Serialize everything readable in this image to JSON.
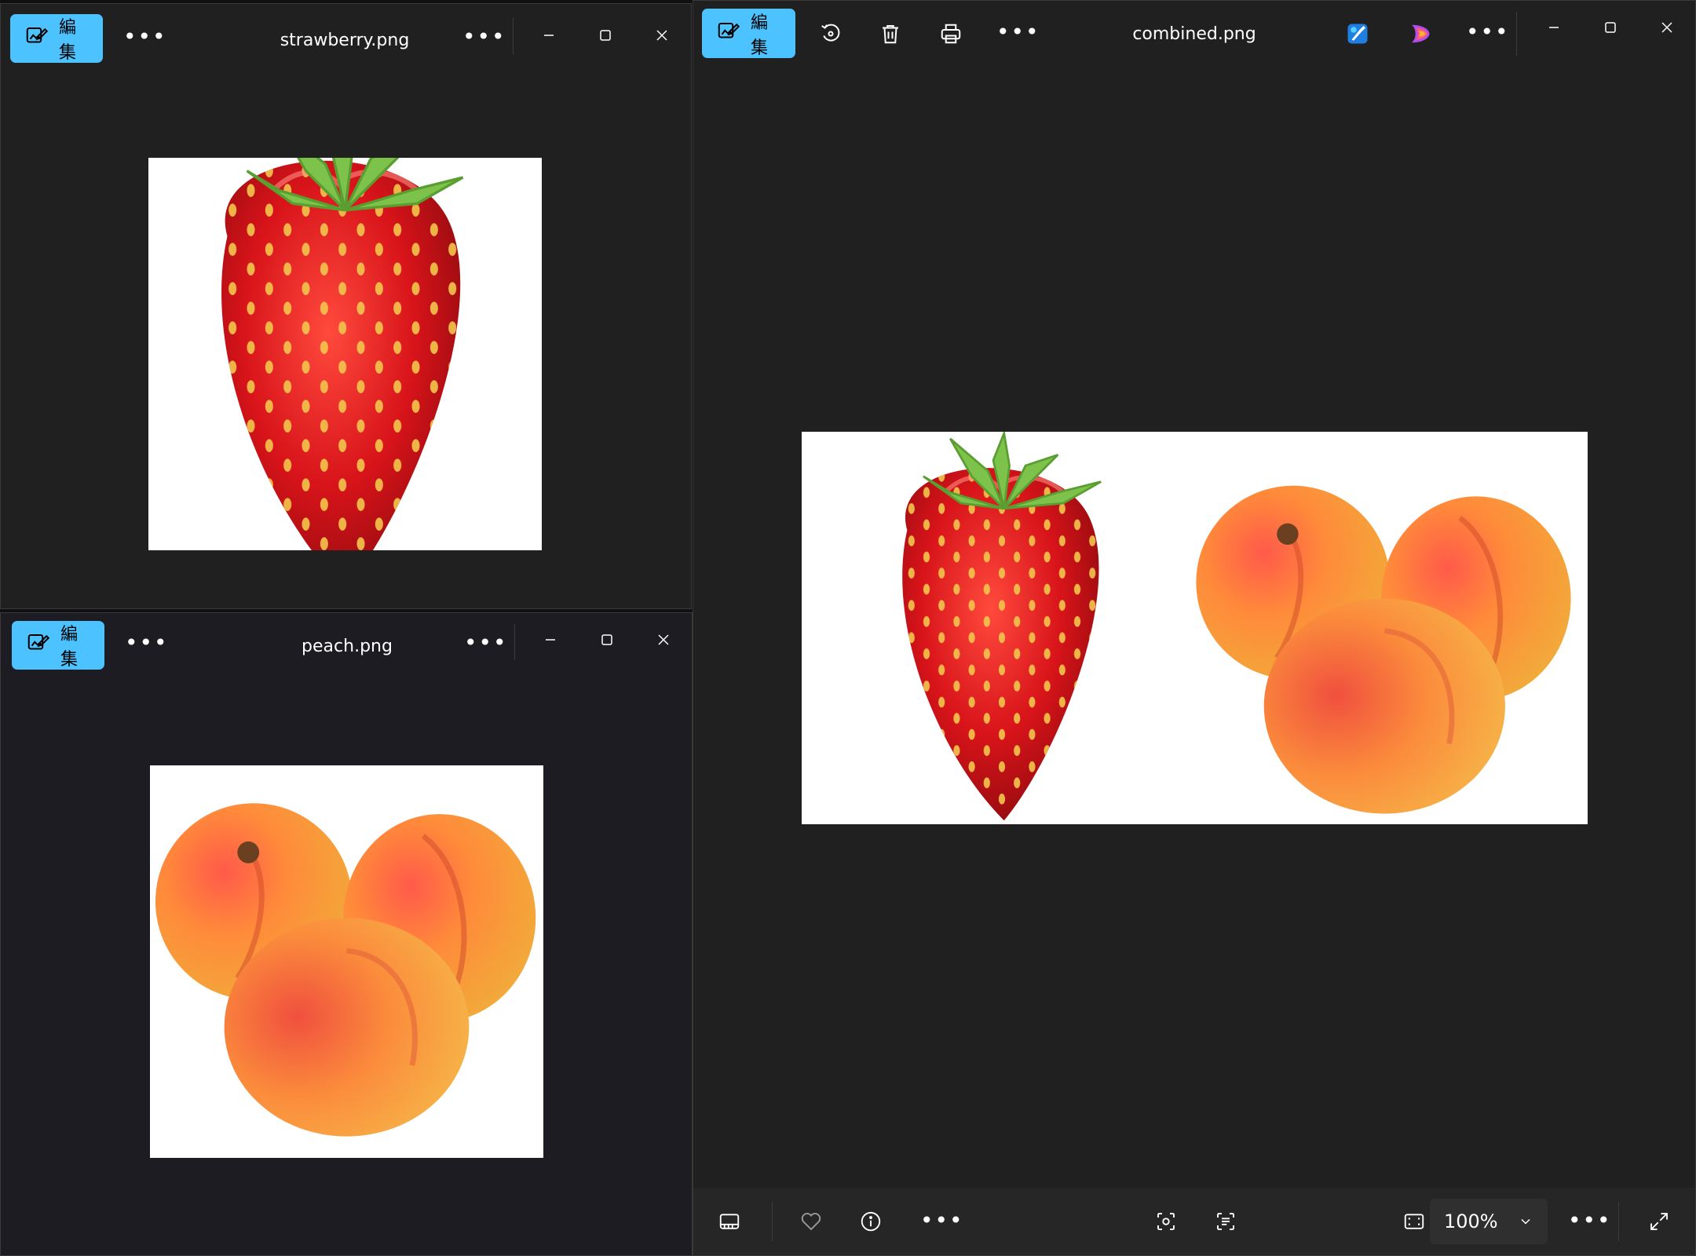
{
  "windows": {
    "strawberry": {
      "edit_label": "編集",
      "filename": "strawberry.png"
    },
    "peach": {
      "edit_label": "編集",
      "filename": "peach.png"
    },
    "combined": {
      "edit_label": "編集",
      "filename": "combined.png",
      "zoom": "100%"
    }
  },
  "icons": {
    "edit": "edit-image-icon",
    "rotate": "rotate-icon",
    "delete": "trash-icon",
    "print": "print-icon",
    "more": "more-icon",
    "designer": "designer-icon",
    "clipchamp": "clipchamp-icon",
    "minimize": "minimize-icon",
    "maximize": "maximize-icon",
    "close": "close-icon",
    "filmstrip": "filmstrip-icon",
    "favorite": "heart-icon",
    "info": "info-icon",
    "visual_search": "visual-search-icon",
    "text_scan": "text-scan-icon",
    "fit": "fit-to-window-icon",
    "fullscreen": "fullscreen-icon"
  },
  "colors": {
    "accent": "#4cc2ff",
    "window_bg": "#202020",
    "bottom_bar": "#262626"
  }
}
